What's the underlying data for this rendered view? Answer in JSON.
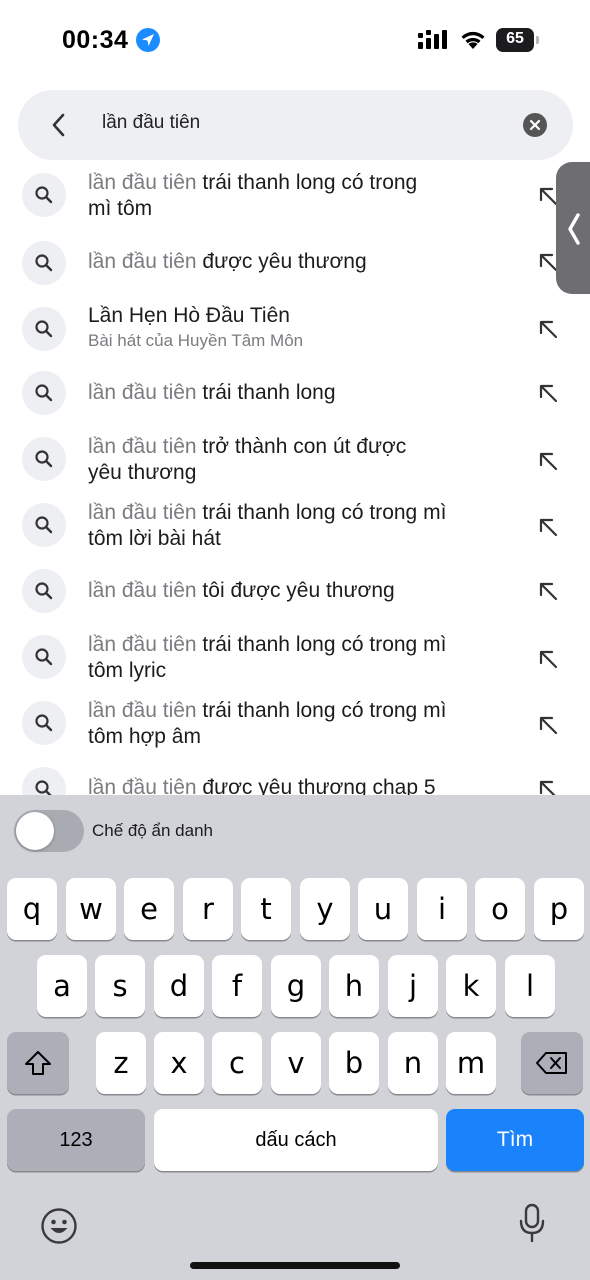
{
  "status_bar": {
    "time": "00:34",
    "battery": "65",
    "icons": [
      "location-arrow-icon",
      "cellular-signal-icon",
      "wifi-icon",
      "battery-icon"
    ]
  },
  "search": {
    "query": "lần đầu tiên",
    "back_icon": "chevron-left-icon",
    "clear_icon": "clear-circle-icon"
  },
  "suggestions": [
    {
      "prefix": "lần đầu tiên",
      "rest_line1": " trái thanh long có trong",
      "line2": "mì tôm",
      "subtitle": ""
    },
    {
      "prefix": "lần đầu tiên",
      "rest_line1": " được yêu thương",
      "line2": "",
      "subtitle": ""
    },
    {
      "prefix": "",
      "rest_line1": "Lần Hẹn Hò Đầu Tiên",
      "line2": "",
      "subtitle": "Bài hát của Huyền Tâm Môn"
    },
    {
      "prefix": "lần đầu tiên",
      "rest_line1": " trái thanh long",
      "line2": "",
      "subtitle": ""
    },
    {
      "prefix": "lần đầu tiên",
      "rest_line1": " trở thành con út được",
      "line2": "yêu thương",
      "subtitle": ""
    },
    {
      "prefix": "lần đầu tiên",
      "rest_line1": " trái thanh long có trong mì",
      "line2": "tôm lời bài hát",
      "subtitle": ""
    },
    {
      "prefix": "lần đầu tiên",
      "rest_line1": " tôi được yêu thương",
      "line2": "",
      "subtitle": ""
    },
    {
      "prefix": "lần đầu tiên",
      "rest_line1": " trái thanh long có trong mì",
      "line2": "tôm lyric",
      "subtitle": ""
    },
    {
      "prefix": "lần đầu tiên",
      "rest_line1": " trái thanh long có trong mì",
      "line2": "tôm hợp âm",
      "subtitle": ""
    },
    {
      "prefix": "lần đầu tiên",
      "rest_line1": " được yêu thương chap 5",
      "line2": "",
      "subtitle": ""
    }
  ],
  "keyboard": {
    "incognito_label": "Chế độ ẩn danh",
    "incognito_on": false,
    "row1": [
      "q",
      "w",
      "e",
      "r",
      "t",
      "y",
      "u",
      "i",
      "o",
      "p"
    ],
    "row2": [
      "a",
      "s",
      "d",
      "f",
      "g",
      "h",
      "j",
      "k",
      "l"
    ],
    "row3": [
      "z",
      "x",
      "c",
      "v",
      "b",
      "n",
      "m"
    ],
    "numbers_label": "123",
    "space_label": "dấu cách",
    "go_label": "Tìm",
    "shift_icon": "shift-icon",
    "delete_icon": "delete-icon",
    "emoji_icon": "emoji-icon",
    "mic_icon": "microphone-icon"
  },
  "colors": {
    "accent": "#1a82fb",
    "location_blue": "#1a8cff",
    "keyboard_bg": "#d1d3d9",
    "search_bg": "#eeeff2"
  }
}
